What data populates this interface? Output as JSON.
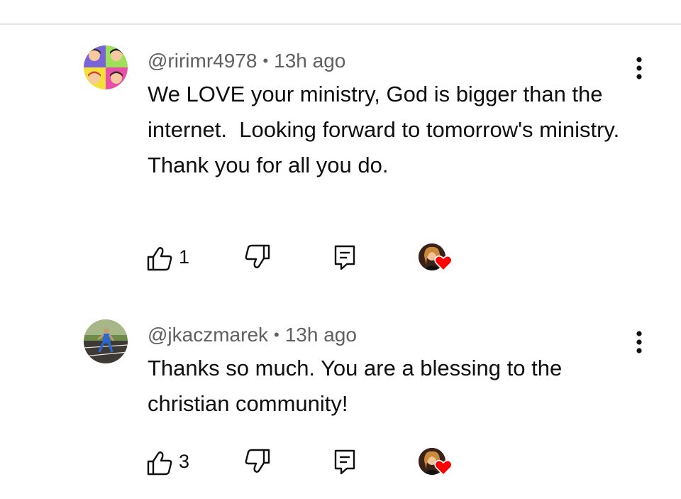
{
  "comments": [
    {
      "handle": "@ririmr4978",
      "separator": "•",
      "time": "13h ago",
      "text": "We LOVE your ministry, God is bigger than the internet.  Looking forward to tomorrow's ministry.  Thank you for all you do.",
      "likes": "1",
      "avatar_icon": "pop-art-portrait-avatar",
      "creator_heart": true
    },
    {
      "handle": "@jkaczmarek",
      "separator": "•",
      "time": "13h ago",
      "text": "Thanks so much. You are a blessing to the christian community!",
      "likes": "3",
      "avatar_icon": "runner-track-avatar",
      "creator_heart": true
    }
  ],
  "icons": {
    "like": "thumbs-up-icon",
    "dislike": "thumbs-down-icon",
    "reply": "reply-icon",
    "menu": "more-vert-icon",
    "heart": "heart-icon"
  },
  "colors": {
    "text": "#0f0f0f",
    "meta": "#606060",
    "heart": "#ff0000",
    "divider": "#e5e5e5"
  }
}
